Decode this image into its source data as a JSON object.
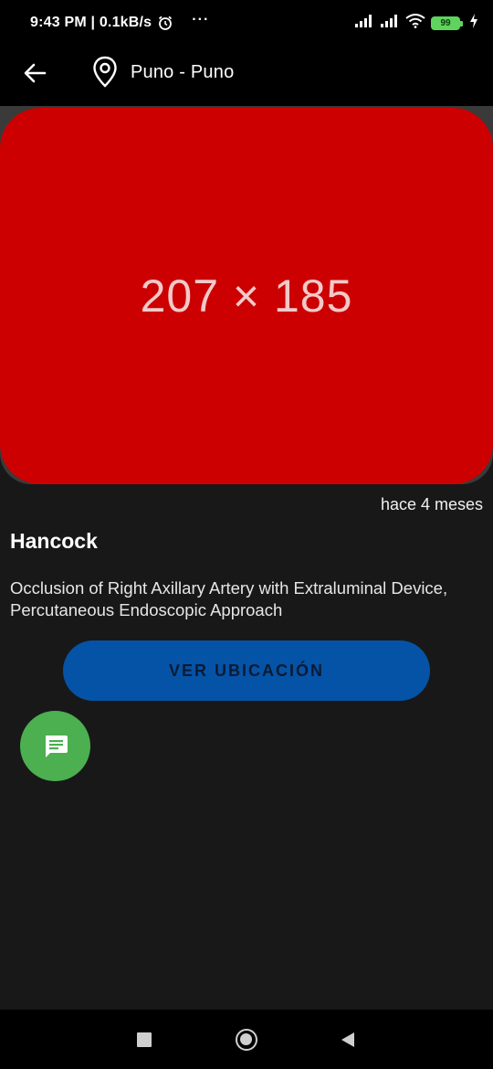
{
  "status_bar": {
    "time": "9:43 PM | 0.1kB/s",
    "more": "···",
    "battery": "99",
    "icons": [
      "alarm-icon",
      "signal-icon",
      "signal-icon",
      "wifi-icon",
      "battery-icon",
      "charging-icon"
    ]
  },
  "app_bar": {
    "back_icon": "arrow-left-icon",
    "location_icon": "location-pin-icon",
    "location": "Puno - Puno"
  },
  "image": {
    "placeholder_text": "207 × 185",
    "color": "#cc0000"
  },
  "post": {
    "time_ago": "hace 4 meses",
    "title": "Hancock",
    "description": "Occlusion of Right Axillary Artery with Extraluminal Device, Percutaneous Endoscopic Approach"
  },
  "actions": {
    "ver_ubicacion": "VER UBICACIÓN",
    "button_color": "#0553a6",
    "fab_icon": "chat-message-icon",
    "fab_color": "#4caf50"
  },
  "nav_bar": {
    "icons": [
      "recent-apps-icon",
      "home-icon",
      "back-triangle-icon"
    ]
  }
}
